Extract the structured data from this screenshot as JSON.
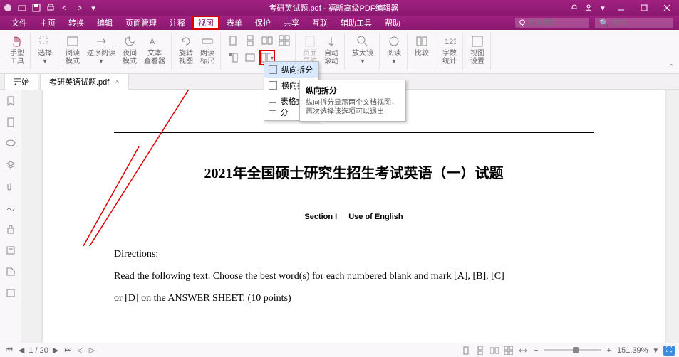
{
  "titlebar": {
    "title": "考研英试题.pdf - 福昕高级PDF编辑器"
  },
  "menus": [
    "文件",
    "主页",
    "转换",
    "编辑",
    "页面管理",
    "注释",
    "视图",
    "表单",
    "保护",
    "共享",
    "互联",
    "辅助工具",
    "帮助"
  ],
  "menu_highlight_index": 6,
  "search_placeholder": "告诉我您...",
  "search2_placeholder": "查找",
  "ribbon": {
    "g1": {
      "a": "手型",
      "b": "工具"
    },
    "g2": "选择",
    "g3": {
      "a": "阅读",
      "b": "模式"
    },
    "g4": "逆序阅读",
    "g5": {
      "a": "夜间",
      "b": "模式"
    },
    "g6": {
      "a": "文本",
      "b": "查看器"
    },
    "g7": {
      "a": "旋转",
      "b": "视图"
    },
    "g8": {
      "a": "朗读",
      "b": "标尺"
    },
    "g9": {
      "a": "页面",
      "b": "导航"
    },
    "g10": {
      "a": "自动",
      "b": "滚动"
    },
    "g11": "放大镜",
    "g12": "阅读",
    "g13": "比较",
    "g14": {
      "a": "字数",
      "b": "统计"
    },
    "g15": {
      "a": "视图",
      "b": "设置"
    }
  },
  "dropdown": {
    "items": [
      "纵向拆分",
      "横向拆分",
      "表格式拆分"
    ],
    "selected": 0
  },
  "tooltip": {
    "title": "纵向拆分",
    "body": "纵向拆分显示两个文档视图，再次选择该选项可以退出"
  },
  "tabs": {
    "tab1": "开始",
    "tab2": "考研英语试题.pdf"
  },
  "doc": {
    "title": "2021年全国硕士研究生招生考试英语（一）试题",
    "section_a": "Section I",
    "section_b": "Use of English",
    "directions": "Directions:",
    "para1": "Read the following text. Choose the best word(s) for each numbered blank and mark [A], [B], [C]",
    "para2": "or [D] on the ANSWER SHEET. (10 points)"
  },
  "status": {
    "page": "1 / 20",
    "zoom": "151.39%"
  }
}
